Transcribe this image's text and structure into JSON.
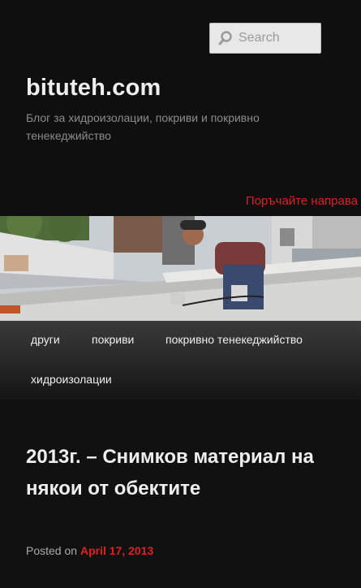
{
  "search": {
    "placeholder": "Search"
  },
  "site": {
    "title": "bituteh.com",
    "description": "Блог за хидроизолации, покриви и покривно тенекеджийство",
    "order_link": "Поръчайте направа"
  },
  "nav": {
    "items": [
      {
        "label": "други"
      },
      {
        "label": "покриви"
      },
      {
        "label": "покривно тенекеджийство"
      },
      {
        "label": "хидроизолации"
      }
    ]
  },
  "post": {
    "title": "2013г. – Снимков материал на някои от обектите",
    "posted_on_label": "Posted on",
    "date": "April 17, 2013"
  },
  "colors": {
    "accent": "#e02020",
    "background": "#111111",
    "text": "#eeeeee"
  }
}
